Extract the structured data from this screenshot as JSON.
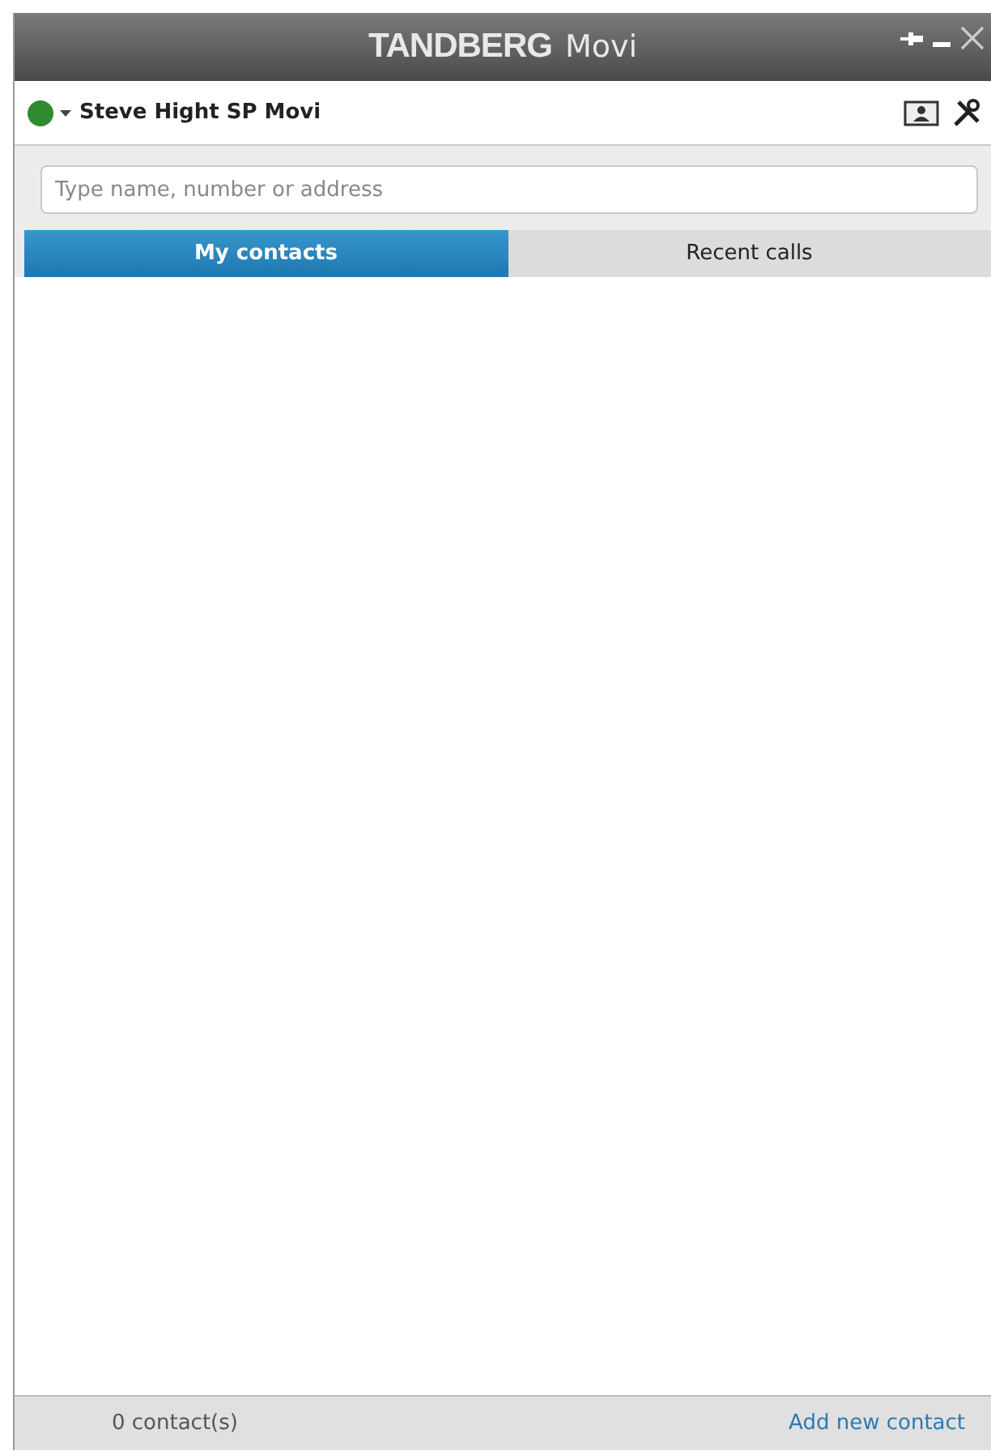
{
  "window": {
    "brand": "TANDBERG",
    "product": "Movi"
  },
  "user": {
    "name": "Steve Hight SP Movi",
    "online": true
  },
  "search": {
    "placeholder": "Type name, number or address"
  },
  "tabs": [
    {
      "label": "My contacts",
      "selected": true
    },
    {
      "label": "Recent calls",
      "selected": false
    }
  ],
  "status_bar": {
    "count": "0 contact(s)",
    "link": "Add new contact"
  }
}
